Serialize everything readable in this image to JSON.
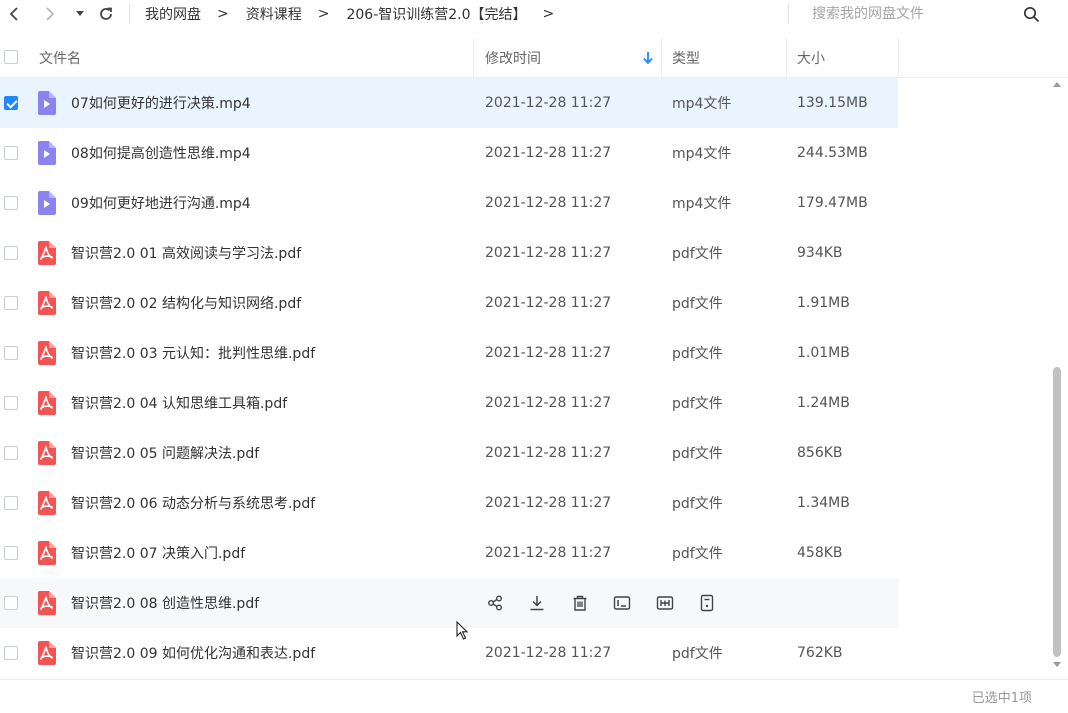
{
  "breadcrumb": [
    "我的网盘",
    "资料课程",
    "206-智识训练营2.0【完结】"
  ],
  "breadcrumb_sep": ">",
  "search": {
    "placeholder": "搜索我的网盘文件"
  },
  "columns": {
    "name": "文件名",
    "modified": "修改时间",
    "type": "类型",
    "size": "大小"
  },
  "status": "已选中1项",
  "colors": {
    "accent": "#1e88ff",
    "video_icon": "#8b84f0",
    "pdf_icon": "#f25454",
    "selected_row": "#eaf4ff"
  },
  "files": [
    {
      "name": "07如何更好的进行决策.mp4",
      "modified": "2021-12-28 11:27",
      "type": "mp4文件",
      "size": "139.15MB",
      "icon": "video-file-icon",
      "checked": true
    },
    {
      "name": "08如何提高创造性思维.mp4",
      "modified": "2021-12-28 11:27",
      "type": "mp4文件",
      "size": "244.53MB",
      "icon": "video-file-icon",
      "checked": false
    },
    {
      "name": "09如何更好地进行沟通.mp4",
      "modified": "2021-12-28 11:27",
      "type": "mp4文件",
      "size": "179.47MB",
      "icon": "video-file-icon",
      "checked": false
    },
    {
      "name": "智识营2.0 01 高效阅读与学习法.pdf",
      "modified": "2021-12-28 11:27",
      "type": "pdf文件",
      "size": "934KB",
      "icon": "pdf-file-icon",
      "checked": false
    },
    {
      "name": "智识营2.0 02 结构化与知识网络.pdf",
      "modified": "2021-12-28 11:27",
      "type": "pdf文件",
      "size": "1.91MB",
      "icon": "pdf-file-icon",
      "checked": false
    },
    {
      "name": "智识营2.0 03 元认知：批判性思维.pdf",
      "modified": "2021-12-28 11:27",
      "type": "pdf文件",
      "size": "1.01MB",
      "icon": "pdf-file-icon",
      "checked": false
    },
    {
      "name": "智识营2.0 04 认知思维工具箱.pdf",
      "modified": "2021-12-28 11:27",
      "type": "pdf文件",
      "size": "1.24MB",
      "icon": "pdf-file-icon",
      "checked": false
    },
    {
      "name": "智识营2.0 05 问题解决法.pdf",
      "modified": "2021-12-28 11:27",
      "type": "pdf文件",
      "size": "856KB",
      "icon": "pdf-file-icon",
      "checked": false
    },
    {
      "name": "智识营2.0 06 动态分析与系统思考.pdf",
      "modified": "2021-12-28 11:27",
      "type": "pdf文件",
      "size": "1.34MB",
      "icon": "pdf-file-icon",
      "checked": false
    },
    {
      "name": "智识营2.0 07 决策入门.pdf",
      "modified": "2021-12-28 11:27",
      "type": "pdf文件",
      "size": "458KB",
      "icon": "pdf-file-icon",
      "checked": false
    },
    {
      "name": "智识营2.0 08 创造性思维.pdf",
      "modified": "",
      "type": "",
      "size": "",
      "icon": "pdf-file-icon",
      "checked": false,
      "hovered": true
    },
    {
      "name": "智识营2.0 09 如何优化沟通和表达.pdf",
      "modified": "2021-12-28 11:27",
      "type": "pdf文件",
      "size": "762KB",
      "icon": "pdf-file-icon",
      "checked": false
    }
  ],
  "row_actions": [
    "share-icon",
    "download-icon",
    "delete-icon",
    "rename-icon",
    "copy-icon",
    "move-icon"
  ]
}
